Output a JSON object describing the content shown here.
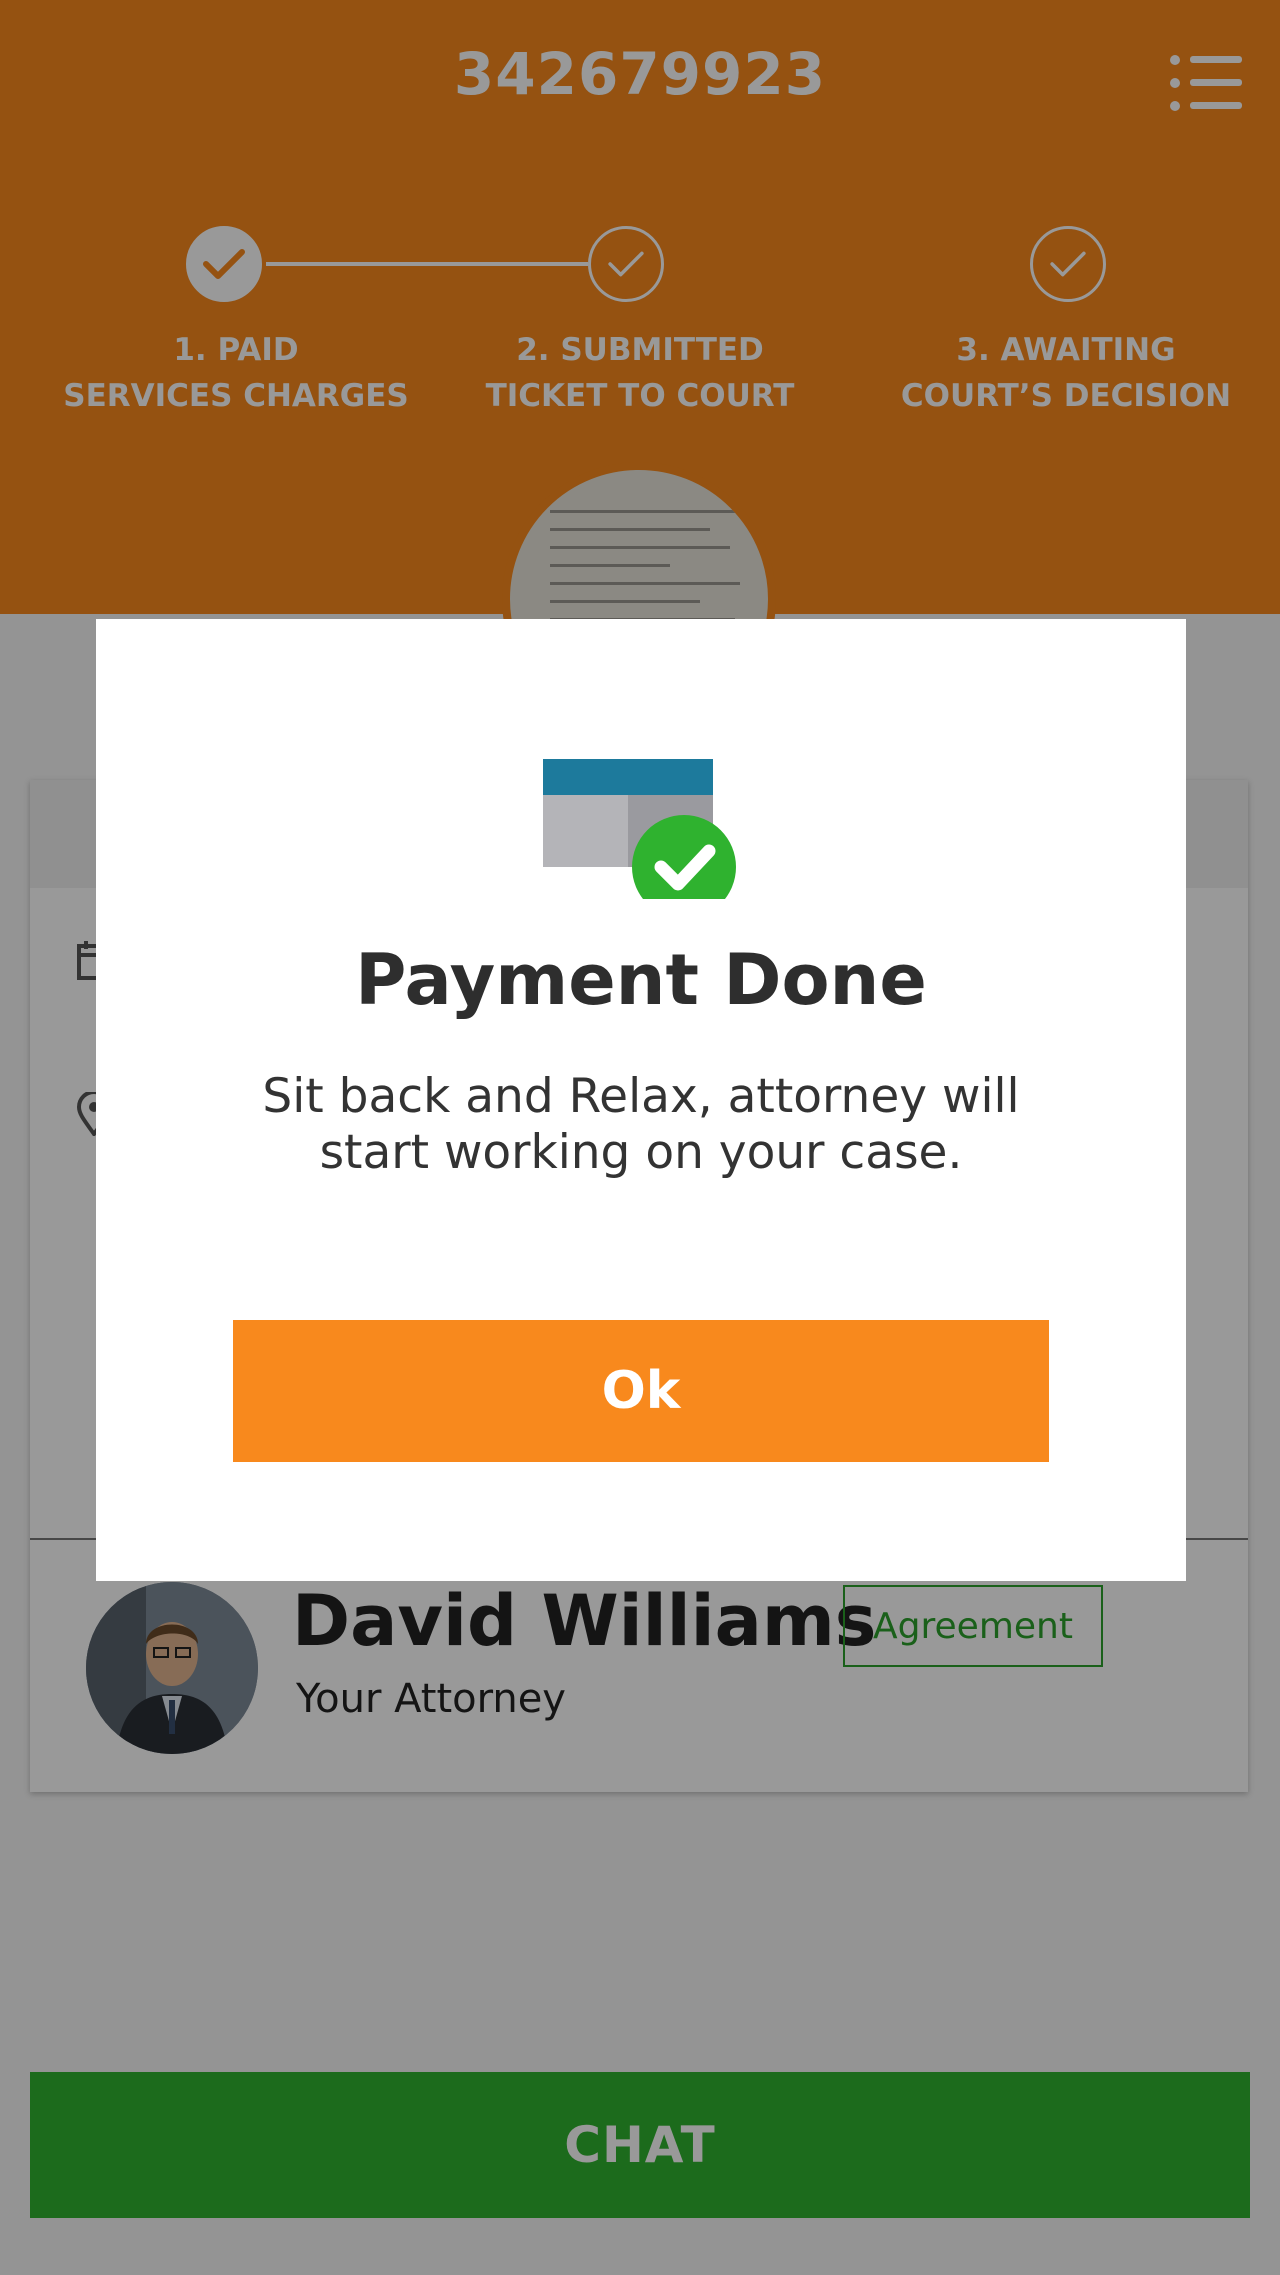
{
  "header": {
    "ticket_number": "342679923",
    "menu_icon": "menu-list-icon",
    "background_color": "#f8891d"
  },
  "steps": [
    {
      "line1": "1. PAID",
      "line2": "SERVICES CHARGES",
      "status": "done"
    },
    {
      "line1": "2. SUBMITTED",
      "line2": "TICKET TO COURT",
      "status": "pending"
    },
    {
      "line1": "3. AWAITING",
      "line2": "COURT’S DECISION",
      "status": "pending"
    }
  ],
  "attorney": {
    "name": "David Williams",
    "role": "Your Attorney",
    "agreement_label": "Agreement"
  },
  "chat": {
    "label": "CHAT",
    "color": "#2fb22f"
  },
  "modal": {
    "icon": "payment-done-icon",
    "title": "Payment Done",
    "message": "Sit back and Relax, attorney will start working on your case.",
    "ok_label": "Ok",
    "button_color": "#f8891d"
  }
}
